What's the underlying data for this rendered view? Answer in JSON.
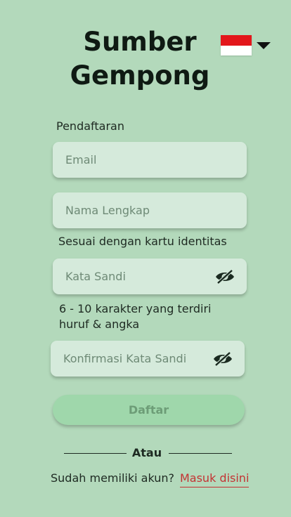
{
  "app": {
    "title_line1": "Sumber",
    "title_line2": "Gempong"
  },
  "language": {
    "flag": "indonesia-flag",
    "colors": [
      "#e3171b",
      "#ffffff"
    ]
  },
  "form": {
    "section_label": "Pendaftaran",
    "email_placeholder": "Email",
    "name_placeholder": "Nama Lengkap",
    "name_hint": "Sesuai  dengan kartu identitas",
    "password_placeholder": "Kata Sandi",
    "password_hint_line1": "6 - 10 karakter  yang terdiri",
    "password_hint_line2": "huruf & angka",
    "confirm_placeholder": "Konfirmasi Kata Sandi",
    "submit_label": "Daftar"
  },
  "footer": {
    "divider_text": "Atau",
    "login_question": "Sudah memiliki akun?",
    "login_link": "Masuk  disini"
  },
  "colors": {
    "background": "#b3d9bb",
    "field": "#d5eadb",
    "button": "#9fd7ab",
    "link": "#c43333"
  }
}
